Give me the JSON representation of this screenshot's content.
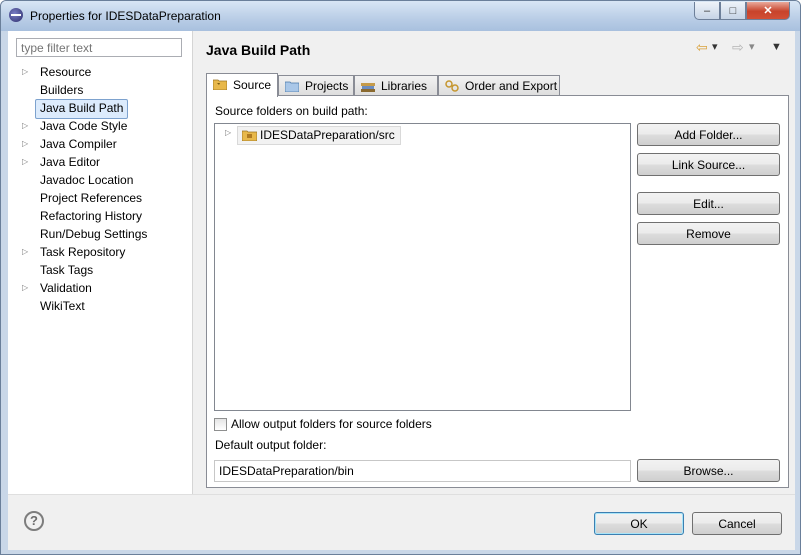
{
  "window": {
    "title": "Properties for IDESDataPreparation",
    "minimize_glyph": "–",
    "maximize_glyph": "□",
    "close_glyph": "✕"
  },
  "filter": {
    "placeholder": "type filter text",
    "value": ""
  },
  "tree": {
    "items": [
      {
        "label": "Resource",
        "expandable": true
      },
      {
        "label": "Builders",
        "expandable": false
      },
      {
        "label": "Java Build Path",
        "expandable": false,
        "selected": true
      },
      {
        "label": "Java Code Style",
        "expandable": true
      },
      {
        "label": "Java Compiler",
        "expandable": true
      },
      {
        "label": "Java Editor",
        "expandable": true
      },
      {
        "label": "Javadoc Location",
        "expandable": false
      },
      {
        "label": "Project References",
        "expandable": false
      },
      {
        "label": "Refactoring History",
        "expandable": false
      },
      {
        "label": "Run/Debug Settings",
        "expandable": false
      },
      {
        "label": "Task Repository",
        "expandable": true
      },
      {
        "label": "Task Tags",
        "expandable": false
      },
      {
        "label": "Validation",
        "expandable": true
      },
      {
        "label": "WikiText",
        "expandable": false
      }
    ]
  },
  "header": {
    "title": "Java Build Path"
  },
  "nav": {
    "back_glyph": "⇦",
    "forward_glyph": "⇨",
    "dropdown_glyph": "▾",
    "menu_glyph": "▼"
  },
  "tabs": [
    {
      "label": "Source",
      "active": true,
      "icon": "source-folder-icon"
    },
    {
      "label": "Projects",
      "active": false,
      "icon": "projects-icon"
    },
    {
      "label": "Libraries",
      "active": false,
      "icon": "libraries-icon"
    },
    {
      "label": "Order and Export",
      "active": false,
      "icon": "order-export-icon"
    }
  ],
  "source": {
    "list_label": "Source folders on build path:",
    "folders": [
      {
        "label": "IDESDataPreparation/src"
      }
    ],
    "buttons": {
      "add_folder": "Add Folder...",
      "link_source": "Link Source...",
      "edit": "Edit...",
      "remove": "Remove"
    },
    "allow_output_label": "Allow output folders for source folders",
    "allow_output_checked": false,
    "default_output_label": "Default output folder:",
    "default_output_value": "IDESDataPreparation/bin",
    "browse_label": "Browse..."
  },
  "footer": {
    "help_glyph": "?",
    "ok_label": "OK",
    "cancel_label": "Cancel"
  },
  "colors": {
    "accent": "#3c7fb1",
    "selection_bg": "#dcebfc",
    "folder_yellow": "#e8b84a"
  }
}
